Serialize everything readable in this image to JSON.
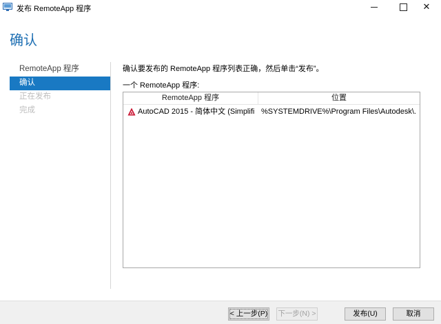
{
  "window": {
    "title": "发布 RemoteApp 程序",
    "minimize_icon": "minimize-icon",
    "maximize_icon": "maximize-icon",
    "close_glyph": "✕"
  },
  "page": {
    "heading": "确认"
  },
  "nav": {
    "items": [
      {
        "label": "RemoteApp 程序",
        "state": "normal"
      },
      {
        "label": "确认",
        "state": "selected"
      },
      {
        "label": "正在发布",
        "state": "disabled"
      },
      {
        "label": "完成",
        "state": "disabled"
      }
    ]
  },
  "content": {
    "instruction": "确认要发布的 RemoteApp 程序列表正确，然后单击“发布”。",
    "list_label": "一个 RemoteApp 程序:",
    "columns": [
      "RemoteApp 程序",
      "位置"
    ],
    "rows": [
      {
        "name": "AutoCAD 2015 - 简体中文 (Simplifi",
        "location": "%SYSTEMDRIVE%\\Program Files\\Autodesk\\...",
        "icon": "autocad-icon"
      }
    ]
  },
  "buttons": {
    "prev": "< 上一步(P)",
    "next": "下一步(N) >",
    "publish": "发布(U)",
    "cancel": "取消"
  },
  "colors": {
    "accent": "#1979c3",
    "heading": "#1e6fb3",
    "autocad": "#c8102e"
  }
}
